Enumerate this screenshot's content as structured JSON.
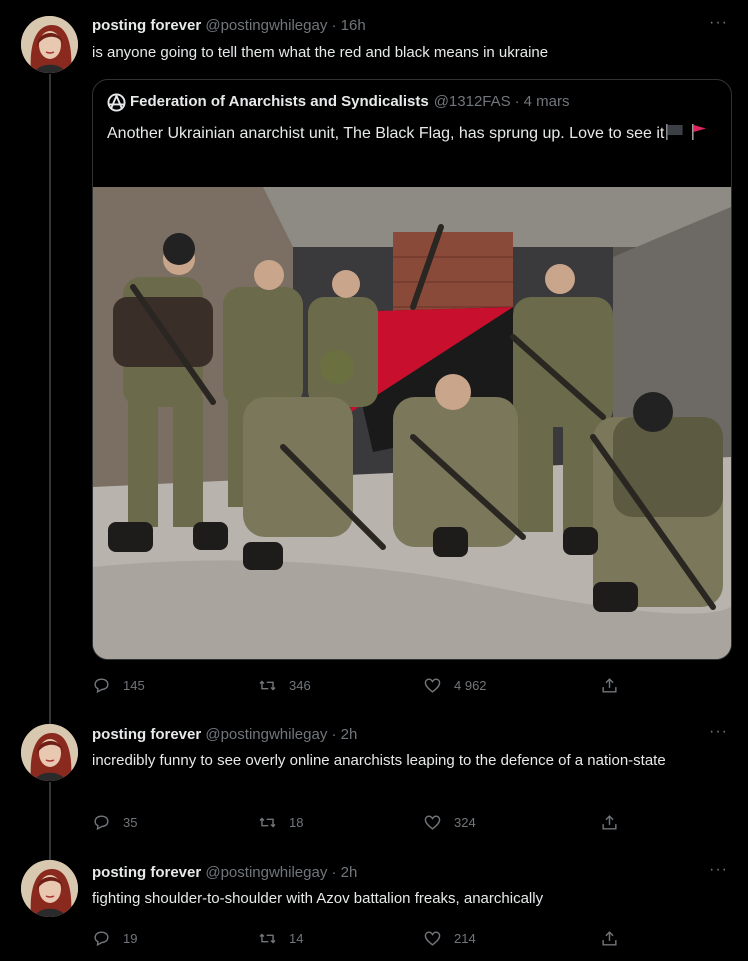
{
  "tweets": [
    {
      "name": "posting forever",
      "handle": "@postingwhilegay",
      "sep": "·",
      "time": "16h",
      "text": "is anyone going to tell them what the red and black means in ukraine",
      "quote": {
        "name": "Federation of Anarchists and Syndicalists",
        "handle": "@1312FAS",
        "sep": "·",
        "time": "4 mars",
        "text": "Another Ukrainian anarchist unit, The Black Flag, has sprung up. Love to see it",
        "flags": [
          "black-flag",
          "red-flag"
        ]
      },
      "replies": "145",
      "retweets": "346",
      "likes": "4 962"
    },
    {
      "name": "posting forever",
      "handle": "@postingwhilegay",
      "sep": "·",
      "time": "2h",
      "text": "incredibly funny to see overly online anarchists leaping to the defence of a nation-state",
      "replies": "35",
      "retweets": "18",
      "likes": "324"
    },
    {
      "name": "posting forever",
      "handle": "@postingwhilegay",
      "sep": "·",
      "time": "2h",
      "text": "fighting shoulder-to-shoulder with Azov battalion freaks, anarchically",
      "replies": "19",
      "retweets": "14",
      "likes": "214"
    }
  ],
  "more_label": "···",
  "colors": {
    "background": "#000000",
    "text": "#e7e9ea",
    "muted": "#71767b",
    "border": "#2f3336",
    "flag_red": "#c8102e",
    "flag_black": "#111111"
  }
}
